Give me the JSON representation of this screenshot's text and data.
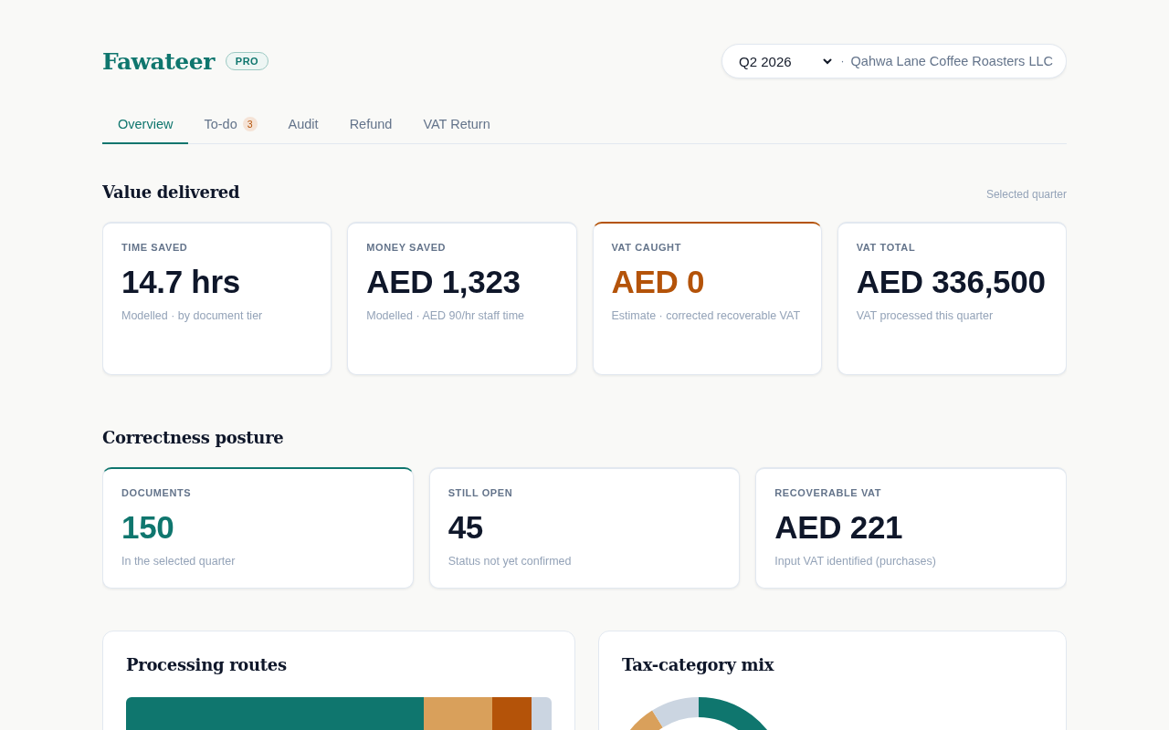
{
  "brand": {
    "name": "Fawateer",
    "badge": "PRO"
  },
  "period": {
    "value": "Q2 2026",
    "separator": "·",
    "company": "Qahwa Lane Coffee Roasters LLC"
  },
  "tabs": [
    {
      "label": "Overview",
      "selected": true
    },
    {
      "label": "To-do",
      "selected": false,
      "count": "3"
    },
    {
      "label": "Audit",
      "selected": false
    },
    {
      "label": "Refund",
      "selected": false
    },
    {
      "label": "VAT Return",
      "selected": false
    }
  ],
  "value_delivered": {
    "title": "Value delivered",
    "note": "Selected quarter",
    "cards": [
      {
        "label": "TIME SAVED",
        "value": "14.7 hrs",
        "caption": "Modelled · by document tier"
      },
      {
        "label": "MONEY SAVED",
        "value": "AED 1,323",
        "caption": "Modelled · AED 90/hr staff time"
      },
      {
        "label": "VAT CAUGHT",
        "value": "AED 0",
        "caption": "Estimate · corrected recoverable VAT",
        "color": "#b45309"
      },
      {
        "label": "VAT TOTAL",
        "value": "AED 336,500",
        "caption": "VAT processed this quarter"
      }
    ]
  },
  "correctness_posture": {
    "title": "Correctness posture",
    "cards": [
      {
        "label": "DOCUMENTS",
        "value": "150",
        "caption": "In the selected quarter",
        "color": "#0f766e"
      },
      {
        "label": "STILL OPEN",
        "value": "45",
        "caption": "Status not yet confirmed"
      },
      {
        "label": "RECOVERABLE VAT",
        "value": "AED 221",
        "caption": "Input VAT identified (purchases)"
      }
    ]
  },
  "panels": [
    {
      "title": "Processing routes",
      "kind": "bar"
    },
    {
      "title": "Tax-category mix",
      "kind": "donut"
    }
  ]
}
